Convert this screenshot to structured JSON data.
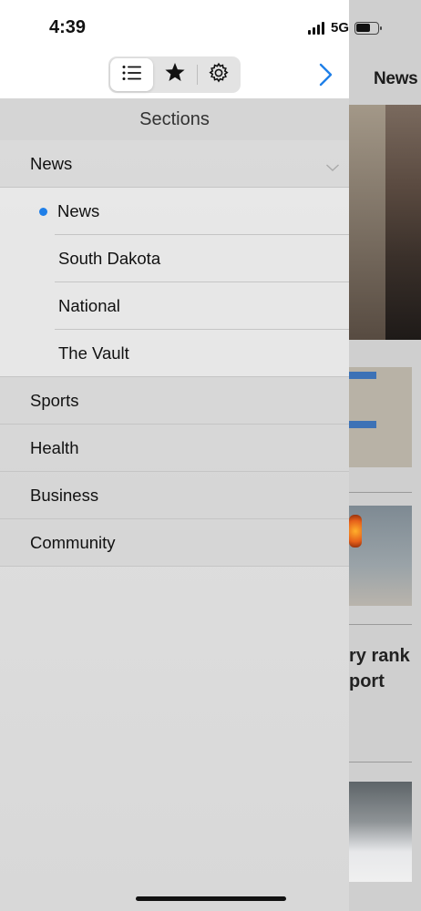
{
  "status_bar": {
    "time": "4:39",
    "network": "5G"
  },
  "toolbar": {
    "segments": [
      {
        "icon": "list-icon",
        "active": true
      },
      {
        "icon": "star-icon",
        "active": false
      },
      {
        "icon": "gear-icon",
        "active": false
      }
    ],
    "forward_icon": "chevron-right-icon"
  },
  "drawer": {
    "header": "Sections",
    "groups": [
      {
        "label": "News",
        "expanded": true,
        "children": [
          {
            "label": "News",
            "selected": true
          },
          {
            "label": "South Dakota",
            "selected": false
          },
          {
            "label": "National",
            "selected": false
          },
          {
            "label": "The Vault",
            "selected": false
          }
        ]
      },
      {
        "label": "Sports"
      },
      {
        "label": "Health"
      },
      {
        "label": "Business"
      },
      {
        "label": "Community"
      }
    ]
  },
  "background": {
    "title": "News",
    "headline_lines": [
      "ry rank",
      "port"
    ]
  },
  "colors": {
    "accent": "#1f7fe8"
  }
}
